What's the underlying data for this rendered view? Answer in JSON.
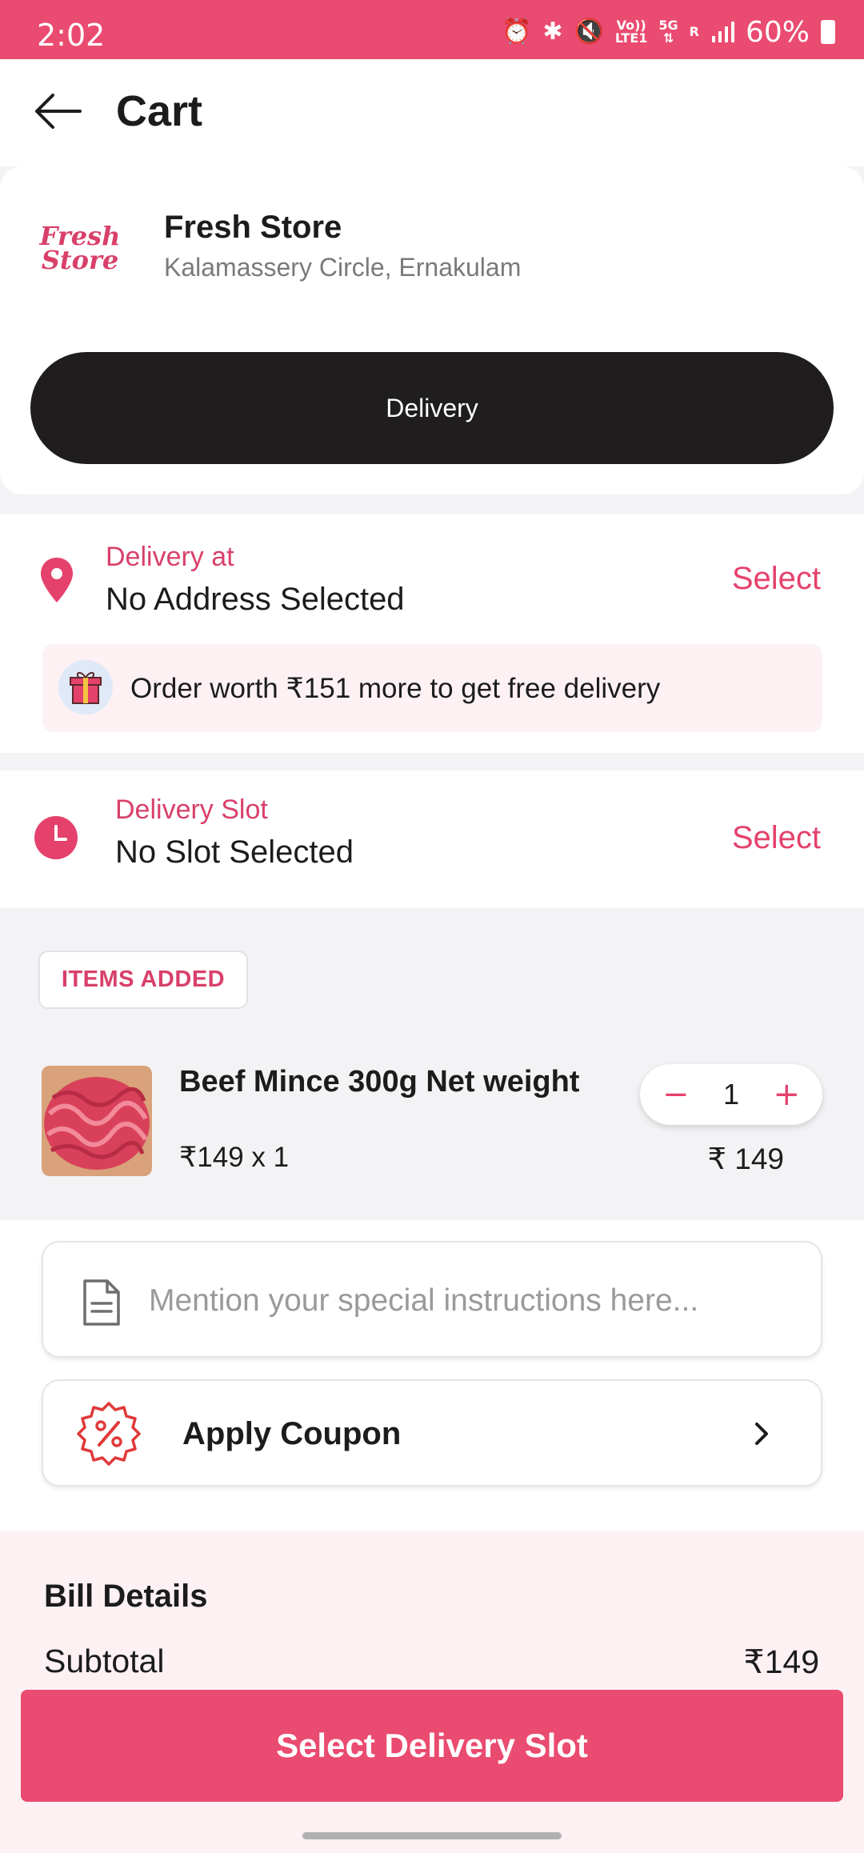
{
  "status_bar": {
    "time": "2:02",
    "volte_label": "Vo))",
    "lte_label": "LTE1",
    "network_5g": "5G",
    "roaming_label": "R",
    "battery": "60%"
  },
  "header": {
    "title": "Cart"
  },
  "store": {
    "logo_line1": "Fresh",
    "logo_line2": "Store",
    "name": "Fresh Store",
    "address": "Kalamassery Circle, Ernakulam",
    "mode_label": "Delivery"
  },
  "delivery_address": {
    "label": "Delivery at",
    "value": "No Address Selected",
    "action": "Select"
  },
  "promo": {
    "text": "Order worth ₹151 more to get free delivery"
  },
  "delivery_slot": {
    "label": "Delivery Slot",
    "value": "No Slot Selected",
    "action": "Select"
  },
  "items": {
    "badge": "ITEMS ADDED",
    "list": [
      {
        "name": "Beef Mince 300g Net weight",
        "price_qty": "₹149 x 1",
        "quantity": "1",
        "total": "₹ 149"
      }
    ]
  },
  "instructions": {
    "placeholder": "Mention your special instructions here..."
  },
  "coupon": {
    "label": "Apply Coupon"
  },
  "bill": {
    "title": "Bill Details",
    "subtotal_label": "Subtotal",
    "subtotal_value": "₹149"
  },
  "cta": {
    "label": "Select Delivery Slot"
  },
  "colors": {
    "accent": "#ea4b70",
    "accent_text": "#d8406a",
    "dark_button": "#1f1d1e",
    "promo_bg": "#fdf1f3"
  },
  "icons": [
    "alarm-icon",
    "bluetooth-icon",
    "mute-icon",
    "signal-icon",
    "battery-icon",
    "back-arrow-icon",
    "location-pin-icon",
    "gift-icon",
    "clock-icon",
    "minus-icon",
    "plus-icon",
    "document-icon",
    "coupon-percent-icon",
    "chevron-right-icon"
  ]
}
